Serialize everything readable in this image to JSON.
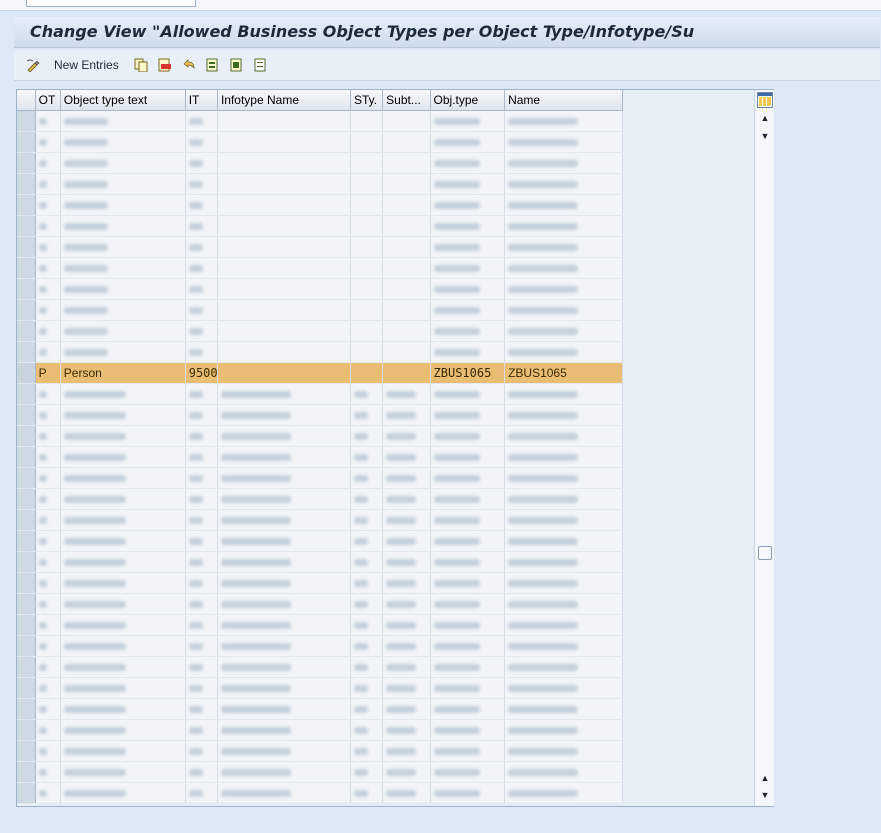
{
  "title": "Change View \"Allowed Business Object Types per Object Type/Infotype/Su",
  "toolbar": {
    "new_entries_label": "New Entries",
    "icons": [
      "change-display-icon",
      "copy-icon",
      "delete-icon",
      "undo-icon",
      "select-all-icon",
      "select-block-icon",
      "deselect-all-icon"
    ]
  },
  "grid": {
    "columns": [
      "OT",
      "Object type text",
      "IT",
      "Infotype Name",
      "STy.",
      "Subt...",
      "Obj.type",
      "Name"
    ],
    "highlighted_row": {
      "ot": "P",
      "object_type_text": "Person",
      "it": "9500",
      "infotype_name": "",
      "sty": "",
      "subt": "",
      "obj_type": "ZBUS1065",
      "name": "ZBUS1065"
    },
    "rows_before_highlight": 12,
    "rows_after_highlight": 20
  },
  "colors": {
    "highlight": "#e9be74",
    "title_bg": "#dbe6f3",
    "app_bg": "#dfe9f5"
  }
}
